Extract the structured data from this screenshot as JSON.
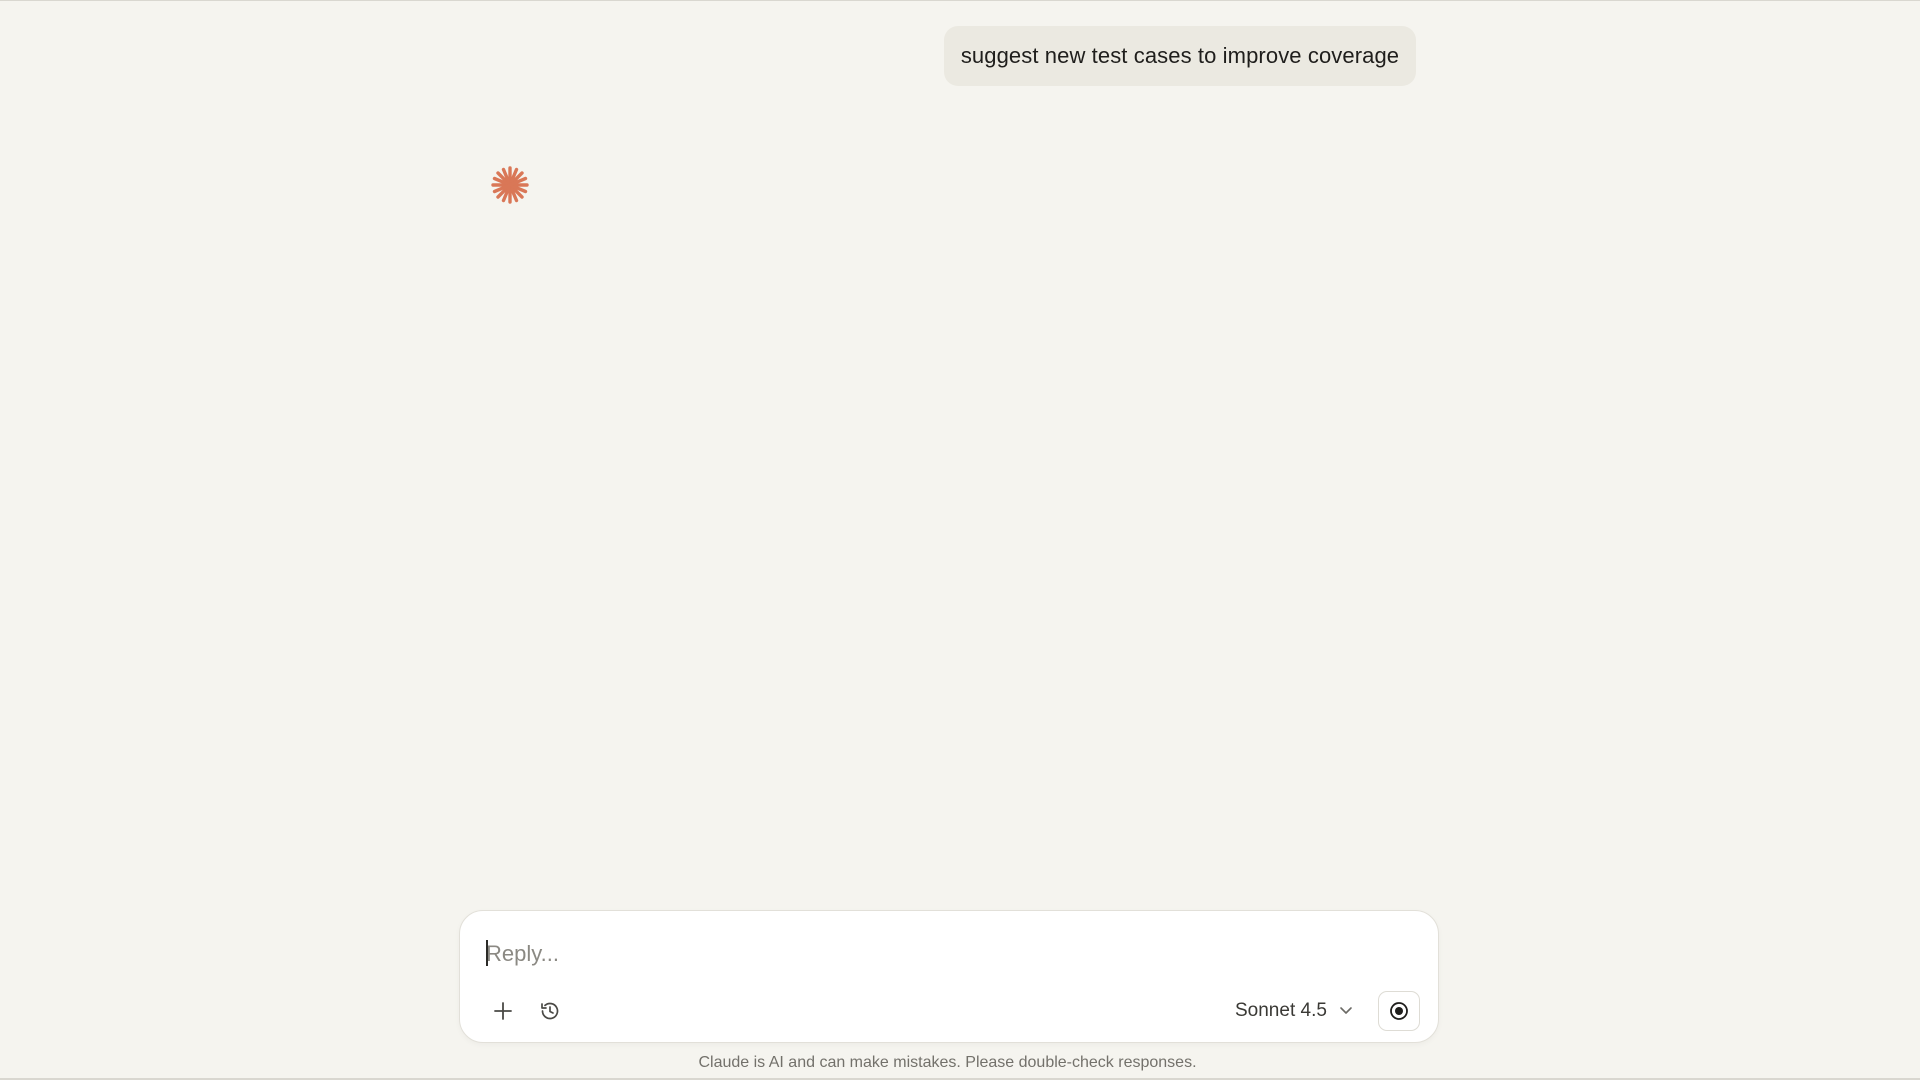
{
  "conversation": {
    "user_message": "suggest new test cases to improve coverage"
  },
  "assistant": {
    "status_icon": "claude-spark-icon",
    "accent_color": "#d97757"
  },
  "composer": {
    "placeholder": "Reply...",
    "value": "",
    "add_icon": "plus-icon",
    "history_icon": "clock-icon",
    "model_label": "Sonnet 4.5",
    "model_icon": "chevron-down-icon",
    "send_icon": "record-icon"
  },
  "footer": {
    "disclaimer": "Claude is AI and can make mistakes. Please double-check responses."
  }
}
